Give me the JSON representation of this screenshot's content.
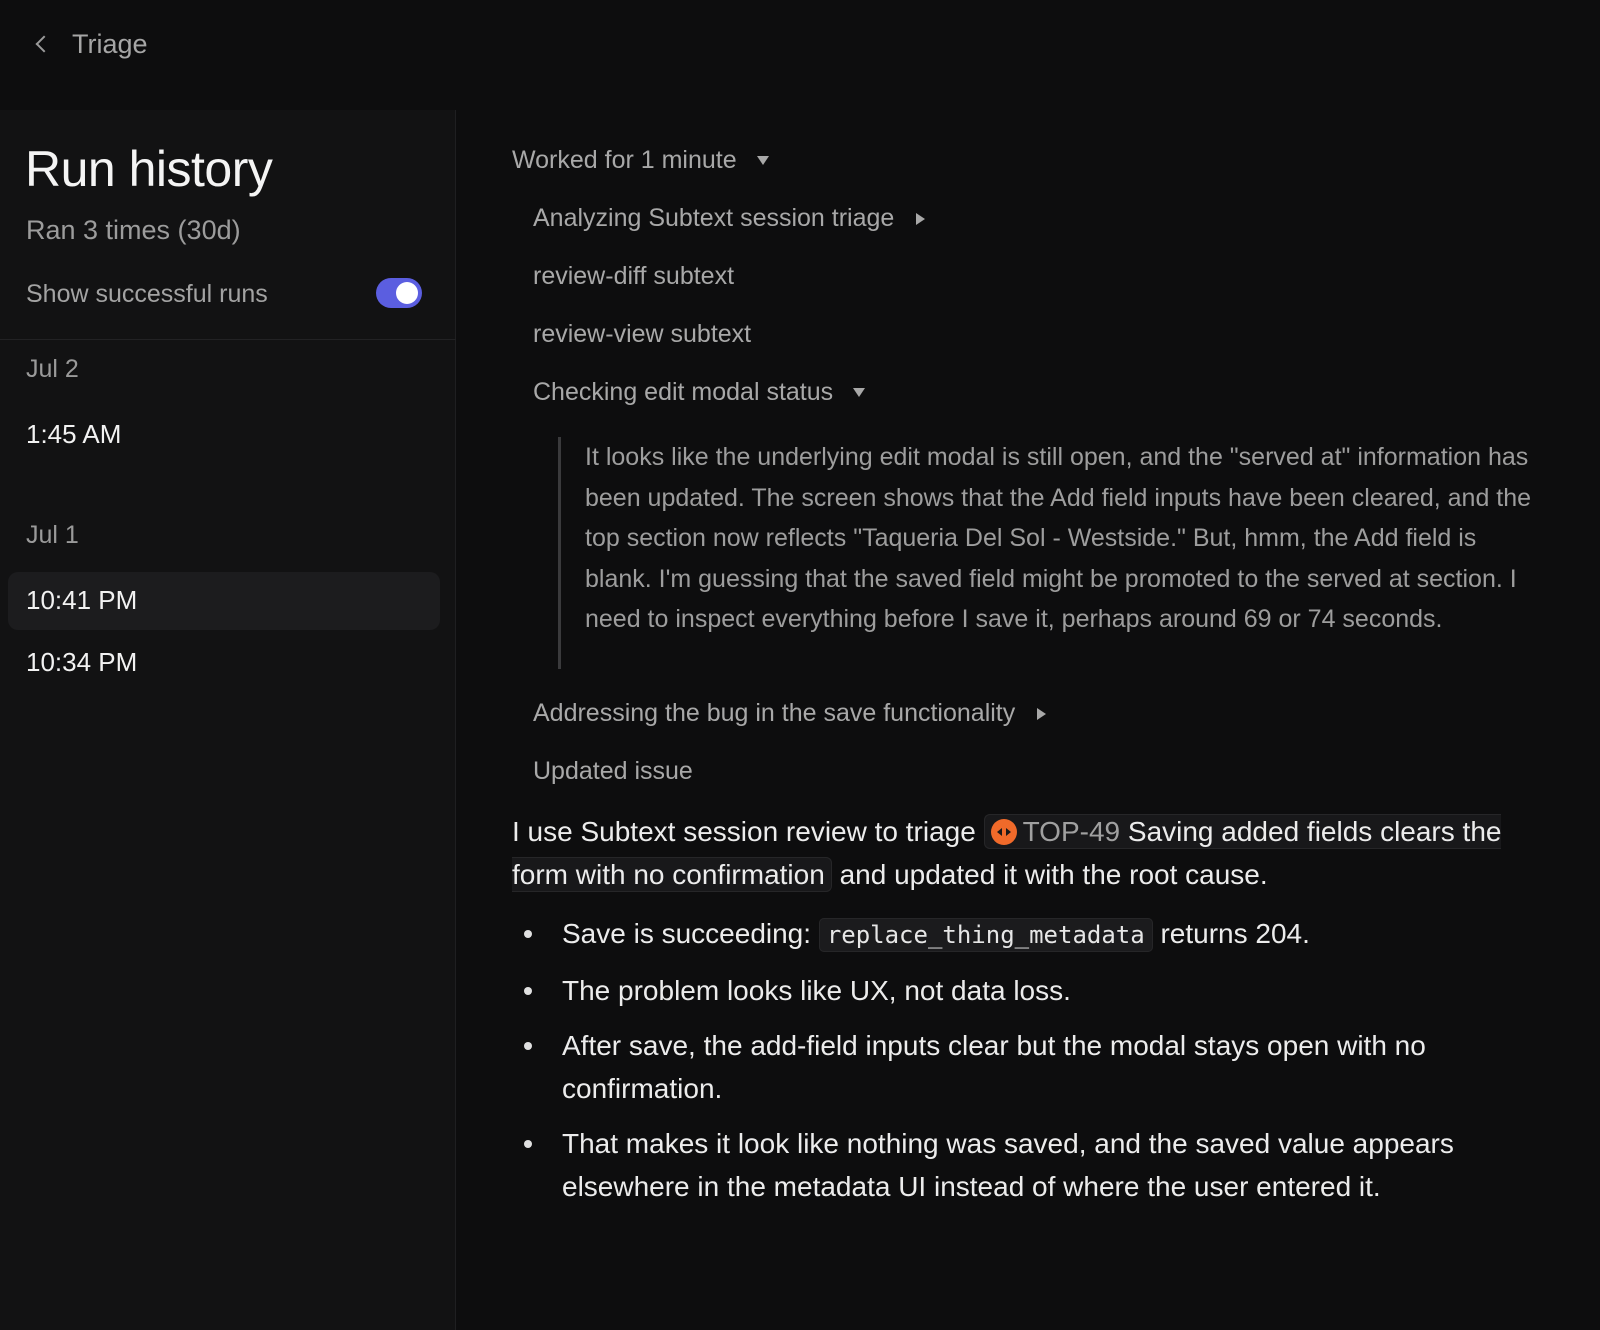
{
  "nav": {
    "back_label": "Triage"
  },
  "sidebar": {
    "title": "Run history",
    "subtitle": "Ran 3 times (30d)",
    "toggle_label": "Show successful runs",
    "toggle_on": true,
    "groups": [
      {
        "date": "Jul 2",
        "runs": [
          {
            "time": "1:45 AM",
            "selected": false
          }
        ]
      },
      {
        "date": "Jul 1",
        "runs": [
          {
            "time": "10:41 PM",
            "selected": true
          },
          {
            "time": "10:34 PM",
            "selected": false
          }
        ]
      }
    ]
  },
  "main": {
    "worked": "Worked for 1 minute",
    "steps": [
      {
        "label": "Analyzing Subtext session triage",
        "state": "collapsed"
      },
      {
        "label": "review-diff subtext",
        "state": "none"
      },
      {
        "label": "review-view subtext",
        "state": "none"
      },
      {
        "label": "Checking edit modal status",
        "state": "expanded"
      },
      {
        "label": "Addressing the bug in the save functionality",
        "state": "collapsed"
      },
      {
        "label": "Updated issue",
        "state": "none"
      }
    ],
    "thought": "It looks like the underlying edit modal is still open, and the \"served at\" information has been updated. The screen shows that the Add field inputs have been cleared, and the top section now reflects \"Taqueria Del Sol - Westside.\" But, hmm, the Add field is blank. I'm guessing that the saved field might be promoted to the served at section. I need to inspect everything before I save it, perhaps around 69 or 74 seconds.",
    "summary": {
      "prefix": "I use Subtext session review to triage ",
      "issue_id": "TOP-49",
      "issue_title": " Saving added fields clears the form with no confirmation",
      "suffix": " and updated it with the root cause."
    },
    "bullets": {
      "b1_pre": "Save is succeeding: ",
      "b1_code": "replace_thing_metadata",
      "b1_post": " returns 204.",
      "b2": "The problem looks like UX, not data loss.",
      "b3": "After save, the add-field inputs clear but the modal stays open with no confirmation.",
      "b4": "That makes it look like nothing was saved, and the saved value appears elsewhere in the metadata UI instead of where the user entered it."
    }
  },
  "colors": {
    "accent": "#5b5ee0",
    "issue_icon": "#f06a2a",
    "background": "#0d0d0e",
    "sidebar": "#121213"
  }
}
